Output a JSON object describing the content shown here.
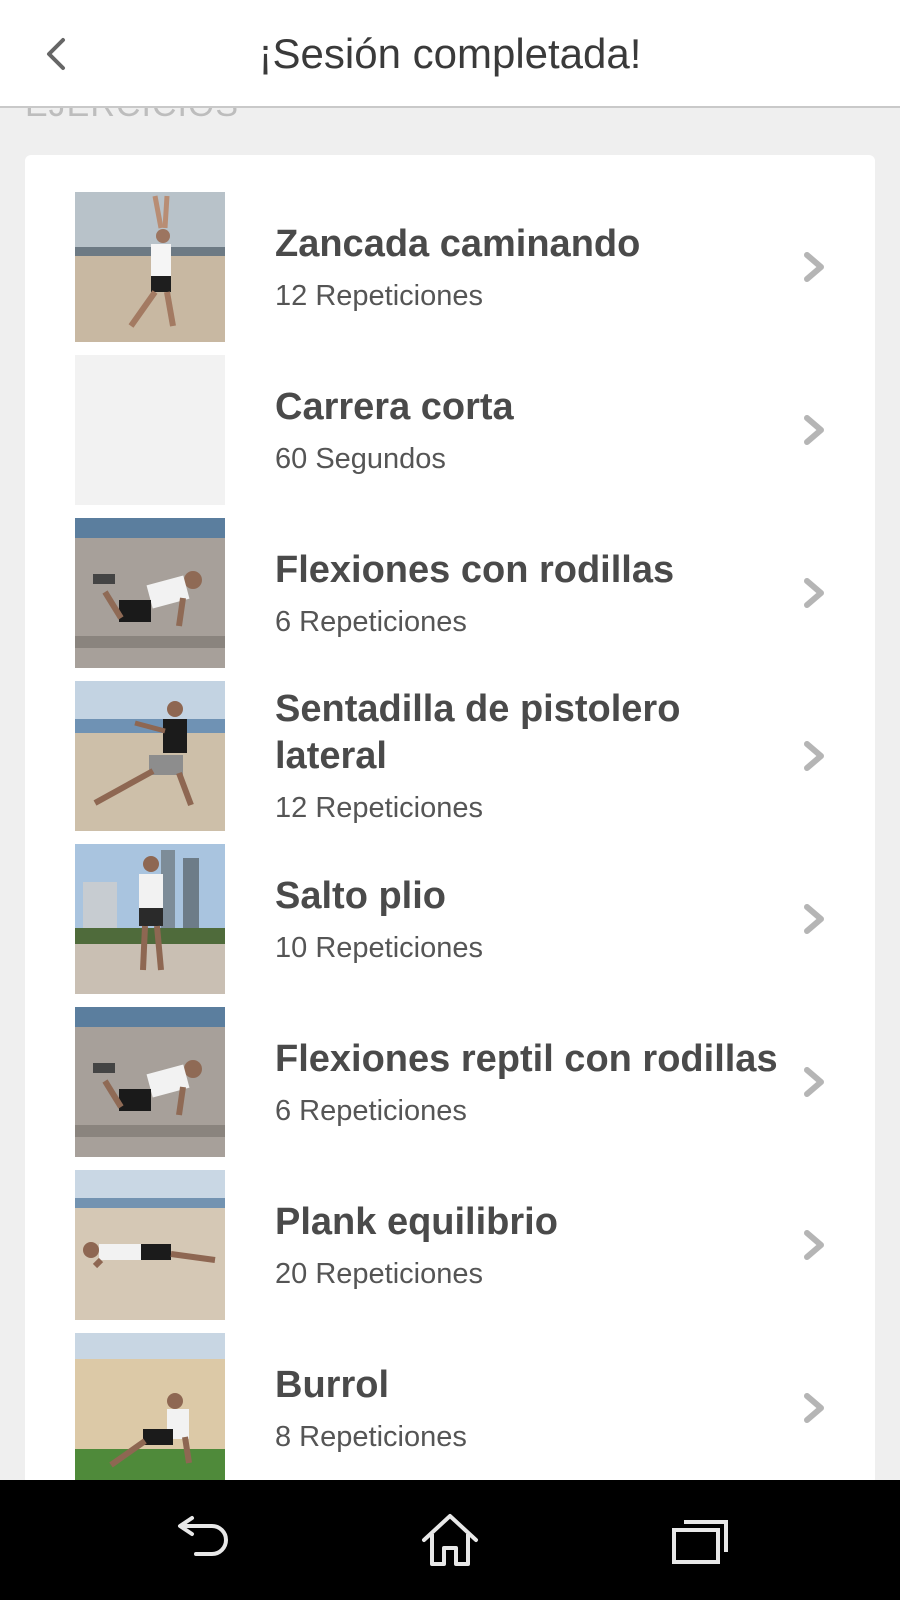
{
  "header": {
    "title": "¡Sesión completada!"
  },
  "section": {
    "label": "EJERCICIOS"
  },
  "exercises": [
    {
      "name": "Zancada caminando",
      "detail": "12 Repeticiones",
      "thumb": "walking-lunge-image"
    },
    {
      "name": "Carrera corta",
      "detail": "60 Segundos",
      "thumb": "empty-image"
    },
    {
      "name": "Flexiones con rodillas",
      "detail": "6 Repeticiones",
      "thumb": "knee-pushup-image"
    },
    {
      "name": "Sentadilla de pistolero lateral",
      "detail": "12 Repeticiones",
      "thumb": "side-squat-image"
    },
    {
      "name": "Salto plio",
      "detail": "10 Repeticiones",
      "thumb": "plyo-jump-image"
    },
    {
      "name": "Flexiones reptil con rodillas",
      "detail": "6 Repeticiones",
      "thumb": "reptile-pushup-image"
    },
    {
      "name": "Plank equilibrio",
      "detail": "20 Repeticiones",
      "thumb": "plank-image"
    },
    {
      "name": "Burrol",
      "detail": "8 Repeticiones",
      "thumb": "burrol-image"
    }
  ],
  "navbar": {
    "back": "back-arrow-icon",
    "home": "home-icon",
    "recents": "recent-apps-icon"
  },
  "colors": {
    "accent": "#3a3a3a",
    "chevron": "#b5b5b5",
    "background": "#efefef"
  }
}
